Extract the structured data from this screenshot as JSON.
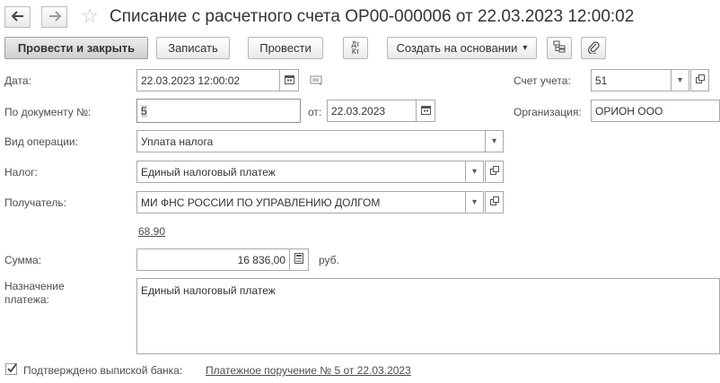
{
  "header": {
    "title": "Списание с расчетного счета ОР00-000006 от 22.03.2023 12:00:02",
    "back_glyph": "🡐",
    "forward_glyph": "🡒",
    "star_glyph": "☆"
  },
  "toolbar": {
    "post_close": "Провести и закрыть",
    "save": "Записать",
    "post": "Провести",
    "dtkt_top": "Дт",
    "dtkt_bottom": "Кт",
    "create_based_on": "Создать на основании",
    "dropdown_glyph": "▾"
  },
  "form": {
    "date_label": "Дата:",
    "date_value": "22.03.2023 12:00:02",
    "doc_num_label": "По документу №:",
    "doc_num_value": "5",
    "from_label": "от:",
    "from_value": "22.03.2023",
    "account_label": "Счет учета:",
    "account_value": "51",
    "org_label": "Организация:",
    "org_value": "ОРИОН ООО",
    "operation_label": "Вид операции:",
    "operation_value": "Уплата налога",
    "tax_label": "Налог:",
    "tax_value": "Единый налоговый платеж",
    "recipient_label": "Получатель:",
    "recipient_value": "МИ ФНС РОССИИ ПО УПРАВЛЕНИЮ ДОЛГОМ",
    "account_link": "68.90",
    "sum_label": "Сумма:",
    "sum_value": "16 836,00",
    "currency": "руб.",
    "purpose_label_1": "Назначение",
    "purpose_label_2": "платежа:",
    "purpose_value": "Единый налоговый платеж",
    "confirmed_label": "Подтверждено выпиской банка:",
    "payment_order_link": "Платежное поручение № 5 от 22.03.2023"
  }
}
